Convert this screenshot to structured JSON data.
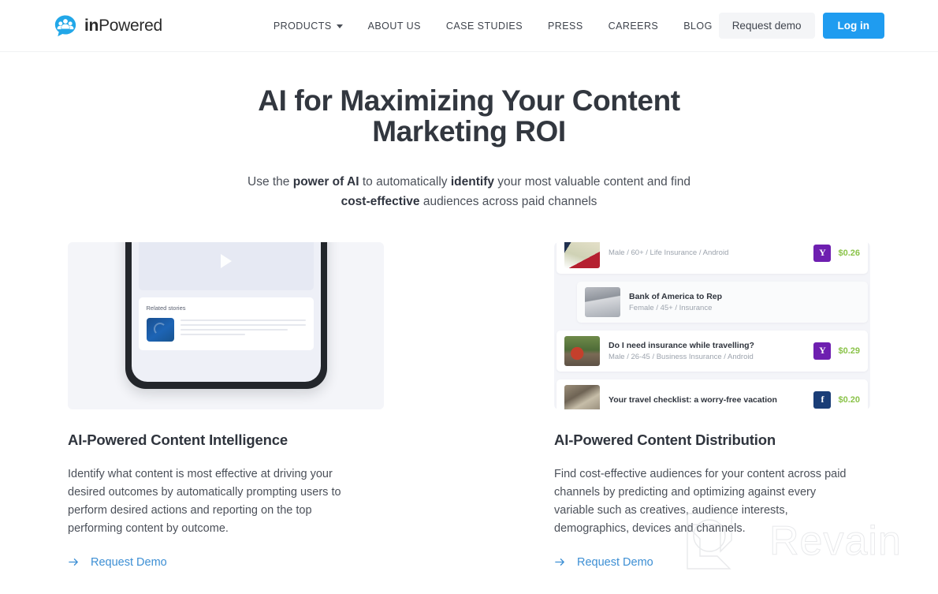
{
  "header": {
    "brand": {
      "bold": "in",
      "light": "Powered",
      "icon": "inpowered-logo-icon"
    },
    "nav": [
      {
        "label": "PRODUCTS",
        "has_caret": true
      },
      {
        "label": "ABOUT US",
        "has_caret": false
      },
      {
        "label": "CASE STUDIES",
        "has_caret": false
      },
      {
        "label": "PRESS",
        "has_caret": false
      },
      {
        "label": "CAREERS",
        "has_caret": false
      },
      {
        "label": "BLOG",
        "has_caret": false
      }
    ],
    "request_demo_label": "Request demo",
    "login_label": "Log in"
  },
  "hero": {
    "title": "AI for Maximizing Your Content Marketing ROI",
    "sub_part1": "Use the ",
    "sub_bold1": "power of AI",
    "sub_part2": " to automatically ",
    "sub_bold2": "identify",
    "sub_part3": " your most valuable content and find ",
    "sub_bold3": "cost-effective",
    "sub_part4": " audiences across paid channels"
  },
  "features": [
    {
      "title": "AI-Powered Content Intelligence",
      "description": "Identify what content is most effective at driving your desired outcomes by automatically prompting users to perform desired actions and reporting on the top performing content by outcome.",
      "link_label": "Request Demo",
      "link_icon": "arrow-right-icon",
      "visual": {
        "kind": "phone-mockup",
        "play_icon": "play-icon",
        "card_title": "Related stories"
      }
    },
    {
      "title": "AI-Powered Content Distribution",
      "description": "Find cost-effective audiences for your content across paid channels by predicting and optimizing against every variable such as creatives, audience interests, demographics, devices and channels.",
      "link_label": "Request Demo",
      "link_icon": "arrow-right-icon",
      "visual": {
        "kind": "feed-mockup",
        "rows": [
          {
            "title": "",
            "meta": "Male / 60+ / Life Insurance / Android",
            "channel": "Y",
            "channel_name": "yahoo",
            "price": "$0.26",
            "thumb": "flag-thumbnail"
          },
          {
            "title": "Bank of America to Rep",
            "meta": "Female / 45+ / Insurance",
            "channel": "",
            "channel_name": "",
            "price": "",
            "thumb": "building-thumbnail"
          },
          {
            "title": "Do I need insurance while travelling?",
            "meta": "Male / 26-45 / Business Insurance / Android",
            "channel": "Y",
            "channel_name": "yahoo",
            "price": "$0.29",
            "thumb": "car-thumbnail"
          },
          {
            "title": "Your travel checklist: a worry-free vacation",
            "meta": "",
            "channel": "f",
            "channel_name": "facebook",
            "price": "$0.20",
            "thumb": "rock-thumbnail"
          }
        ]
      }
    }
  ],
  "watermark": {
    "text": "Revain",
    "icon": "revain-logo-icon"
  },
  "colors": {
    "accent_blue": "#1f9cf0",
    "link_blue": "#3d8fd4",
    "price_green": "#8bc34a",
    "yahoo_purple": "#6e1fb0",
    "facebook_blue": "#1a3d77",
    "text_dark": "#2f343d",
    "text_body": "#4b5059"
  }
}
